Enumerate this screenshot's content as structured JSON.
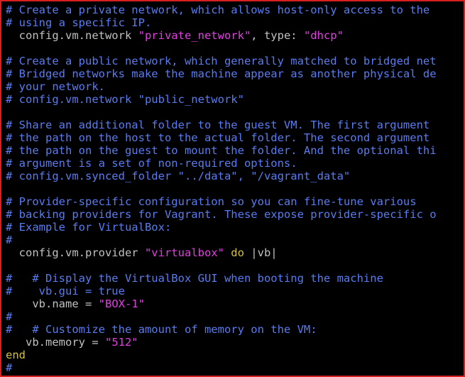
{
  "editor": {
    "lines": [
      [
        {
          "t": "# Create a private network, which allows host-only access to the",
          "c": "comment"
        }
      ],
      [
        {
          "t": "# using a specific IP.",
          "c": "comment"
        }
      ],
      [
        {
          "t": "  config.vm.network ",
          "c": "plain"
        },
        {
          "t": "\"private_network\"",
          "c": "string"
        },
        {
          "t": ", type: ",
          "c": "plain"
        },
        {
          "t": "\"dhcp\"",
          "c": "string"
        }
      ],
      [],
      [
        {
          "t": "# Create a public network, which generally matched to bridged net",
          "c": "comment"
        }
      ],
      [
        {
          "t": "# Bridged networks make the machine appear as another physical de",
          "c": "comment"
        }
      ],
      [
        {
          "t": "# your network.",
          "c": "comment"
        }
      ],
      [
        {
          "t": "# config.vm.network \"public_network\"",
          "c": "comment"
        }
      ],
      [],
      [
        {
          "t": "# Share an additional folder to the guest VM. The first argument",
          "c": "comment"
        }
      ],
      [
        {
          "t": "# the path on the host to the actual folder. The second argument",
          "c": "comment"
        }
      ],
      [
        {
          "t": "# the path on the guest to mount the folder. And the optional thi",
          "c": "comment"
        }
      ],
      [
        {
          "t": "# argument is a set of non-required options.",
          "c": "comment"
        }
      ],
      [
        {
          "t": "# config.vm.synced_folder \"../data\", \"/vagrant_data\"",
          "c": "comment"
        }
      ],
      [],
      [
        {
          "t": "# Provider-specific configuration so you can fine-tune various",
          "c": "comment"
        }
      ],
      [
        {
          "t": "# backing providers for Vagrant. These expose provider-specific o",
          "c": "comment"
        }
      ],
      [
        {
          "t": "# Example for VirtualBox:",
          "c": "comment"
        }
      ],
      [
        {
          "t": "#",
          "c": "comment"
        }
      ],
      [
        {
          "t": "  config.vm.provider ",
          "c": "plain"
        },
        {
          "t": "\"virtualbox\"",
          "c": "string"
        },
        {
          "t": " ",
          "c": "plain"
        },
        {
          "t": "do",
          "c": "keyword"
        },
        {
          "t": " |vb|",
          "c": "plain"
        }
      ],
      [],
      [
        {
          "t": "#   # Display the VirtualBox GUI when booting the machine",
          "c": "comment"
        }
      ],
      [
        {
          "t": "#    vb.gui = true",
          "c": "comment"
        }
      ],
      [
        {
          "t": "    vb.name = ",
          "c": "plain"
        },
        {
          "t": "\"BOX-1\"",
          "c": "string"
        }
      ],
      [
        {
          "t": "#",
          "c": "comment"
        }
      ],
      [
        {
          "t": "#   # Customize the amount of memory on the VM:",
          "c": "comment"
        }
      ],
      [
        {
          "t": "   vb.memory = ",
          "c": "plain"
        },
        {
          "t": "\"512\"",
          "c": "string"
        }
      ],
      [
        {
          "t": "end",
          "c": "keyword"
        }
      ],
      [
        {
          "t": "#",
          "c": "comment"
        }
      ]
    ]
  },
  "colors": {
    "background": "#000000",
    "border": "#d92020",
    "comment": "#5a7cf0",
    "string": "#e23ee2",
    "keyword": "#d4c234",
    "plain": "#c0c0c0"
  }
}
